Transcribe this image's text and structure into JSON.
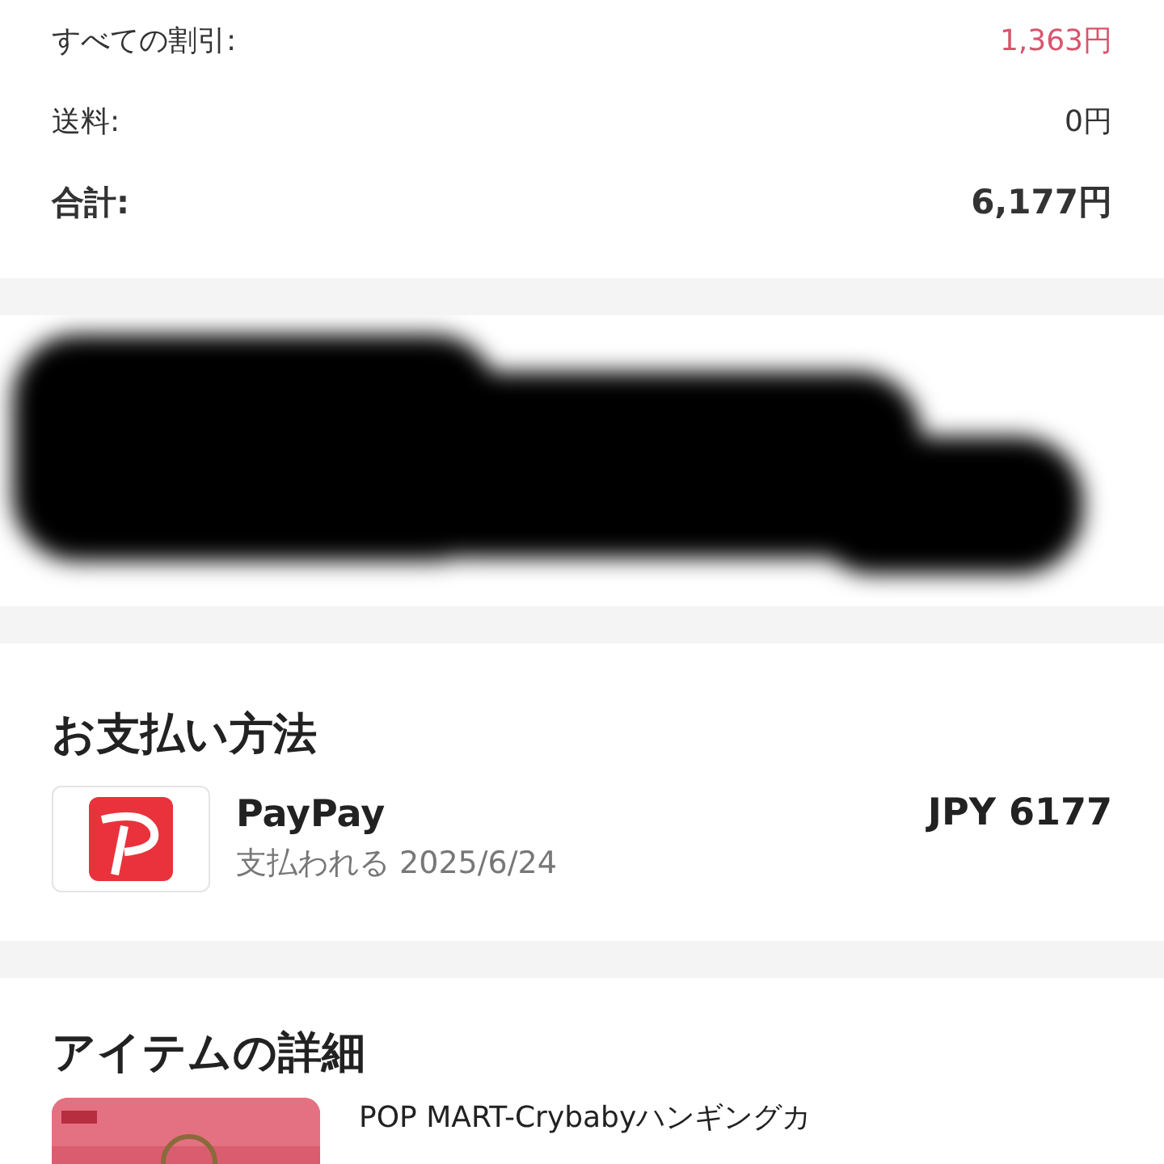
{
  "summary": {
    "rows": [
      {
        "label": "すべての割引:",
        "value": "1,363円",
        "kind": "discount"
      },
      {
        "label": "送料:",
        "value": "0円",
        "kind": "normal"
      },
      {
        "label": "合計:",
        "value": "6,177円",
        "kind": "total"
      }
    ]
  },
  "address": {
    "redacted": true
  },
  "payment": {
    "title": "お支払い方法",
    "method": "PayPay",
    "status": "支払われる 2025/6/24",
    "amount": "JPY 6177"
  },
  "items": {
    "title": "アイテムの詳細",
    "list": [
      {
        "name": "POP MART-Crybabyハンギングカ",
        "kind": "picture"
      }
    ]
  }
}
